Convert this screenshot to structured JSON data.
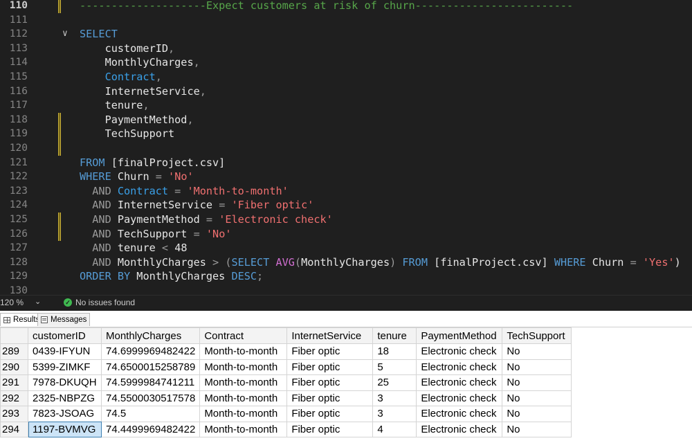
{
  "editor": {
    "lines": [
      {
        "num": "110",
        "current": true,
        "mark": true,
        "segments": [
          {
            "t": "--------------------Expect customers at risk of churn-------------------------",
            "c": "cm"
          }
        ]
      },
      {
        "num": "111",
        "segments": []
      },
      {
        "num": "112",
        "fold": true,
        "segments": [
          {
            "t": "SELECT",
            "c": "kw"
          }
        ]
      },
      {
        "num": "113",
        "segments": [
          {
            "t": "    customerID",
            "c": "ident"
          },
          {
            "t": ",",
            "c": "gray"
          }
        ]
      },
      {
        "num": "114",
        "segments": [
          {
            "t": "    MonthlyCharges",
            "c": "ident"
          },
          {
            "t": ",",
            "c": "gray"
          }
        ]
      },
      {
        "num": "115",
        "segments": [
          {
            "t": "    Contract",
            "c": "blue"
          },
          {
            "t": ",",
            "c": "gray"
          }
        ]
      },
      {
        "num": "116",
        "segments": [
          {
            "t": "    InternetService",
            "c": "ident"
          },
          {
            "t": ",",
            "c": "gray"
          }
        ]
      },
      {
        "num": "117",
        "segments": [
          {
            "t": "    tenure",
            "c": "ident"
          },
          {
            "t": ",",
            "c": "gray"
          }
        ]
      },
      {
        "num": "118",
        "mark": true,
        "segments": [
          {
            "t": "    PaymentMethod",
            "c": "ident"
          },
          {
            "t": ",",
            "c": "gray"
          }
        ]
      },
      {
        "num": "119",
        "mark": true,
        "segments": [
          {
            "t": "    TechSupport",
            "c": "ident"
          }
        ]
      },
      {
        "num": "120",
        "mark": true,
        "segments": []
      },
      {
        "num": "121",
        "segments": [
          {
            "t": "FROM ",
            "c": "kw"
          },
          {
            "t": "[finalProject.csv]",
            "c": "ident"
          }
        ]
      },
      {
        "num": "122",
        "segments": [
          {
            "t": "WHERE ",
            "c": "kw"
          },
          {
            "t": "Churn ",
            "c": "ident"
          },
          {
            "t": "= ",
            "c": "gray"
          },
          {
            "t": "'No'",
            "c": "str"
          }
        ]
      },
      {
        "num": "123",
        "segments": [
          {
            "t": "  AND ",
            "c": "gray"
          },
          {
            "t": "Contract ",
            "c": "blue"
          },
          {
            "t": "= ",
            "c": "gray"
          },
          {
            "t": "'Month-to-month'",
            "c": "str"
          }
        ]
      },
      {
        "num": "124",
        "segments": [
          {
            "t": "  AND ",
            "c": "gray"
          },
          {
            "t": "InternetService ",
            "c": "ident"
          },
          {
            "t": "= ",
            "c": "gray"
          },
          {
            "t": "'Fiber optic'",
            "c": "str"
          }
        ]
      },
      {
        "num": "125",
        "mark": true,
        "segments": [
          {
            "t": "  AND ",
            "c": "gray"
          },
          {
            "t": "PaymentMethod ",
            "c": "ident"
          },
          {
            "t": "= ",
            "c": "gray"
          },
          {
            "t": "'Electronic check'",
            "c": "str"
          }
        ]
      },
      {
        "num": "126",
        "mark": true,
        "segments": [
          {
            "t": "  AND ",
            "c": "gray"
          },
          {
            "t": "TechSupport ",
            "c": "ident"
          },
          {
            "t": "= ",
            "c": "gray"
          },
          {
            "t": "'No'",
            "c": "str"
          }
        ]
      },
      {
        "num": "127",
        "segments": [
          {
            "t": "  AND ",
            "c": "gray"
          },
          {
            "t": "tenure ",
            "c": "ident"
          },
          {
            "t": "< ",
            "c": "gray"
          },
          {
            "t": "48",
            "c": "ident"
          }
        ]
      },
      {
        "num": "128",
        "segments": [
          {
            "t": "  AND ",
            "c": "gray"
          },
          {
            "t": "MonthlyCharges ",
            "c": "ident"
          },
          {
            "t": "> (",
            "c": "gray"
          },
          {
            "t": "SELECT ",
            "c": "kw"
          },
          {
            "t": "AVG",
            "c": "fn"
          },
          {
            "t": "(",
            "c": "gray"
          },
          {
            "t": "MonthlyCharges",
            "c": "ident"
          },
          {
            "t": ") ",
            "c": "gray"
          },
          {
            "t": "FROM ",
            "c": "kw"
          },
          {
            "t": "[finalProject.csv] ",
            "c": "ident"
          },
          {
            "t": "WHERE ",
            "c": "kw"
          },
          {
            "t": "Churn ",
            "c": "ident"
          },
          {
            "t": "= ",
            "c": "gray"
          },
          {
            "t": "'Yes'",
            "c": "str"
          },
          {
            "t": ")",
            "c": "ident"
          }
        ]
      },
      {
        "num": "129",
        "segments": [
          {
            "t": "ORDER BY ",
            "c": "kw"
          },
          {
            "t": "MonthlyCharges ",
            "c": "ident"
          },
          {
            "t": "DESC",
            "c": "kw"
          },
          {
            "t": ";",
            "c": "gray"
          }
        ]
      },
      {
        "num": "130",
        "segments": []
      }
    ]
  },
  "status": {
    "zoom": "120 %",
    "issues": "No issues found"
  },
  "tabs": {
    "results": "Results",
    "messages": "Messages"
  },
  "grid": {
    "columns": [
      "customerID",
      "MonthlyCharges",
      "Contract",
      "InternetService",
      "tenure",
      "PaymentMethod",
      "TechSupport"
    ],
    "rows": [
      {
        "num": "289",
        "cells": [
          "0439-IFYUN",
          "74.6999969482422",
          "Month-to-month",
          "Fiber optic",
          "18",
          "Electronic check",
          "No"
        ]
      },
      {
        "num": "290",
        "cells": [
          "5399-ZIMKF",
          "74.6500015258789",
          "Month-to-month",
          "Fiber optic",
          "5",
          "Electronic check",
          "No"
        ]
      },
      {
        "num": "291",
        "cells": [
          "7978-DKUQH",
          "74.5999984741211",
          "Month-to-month",
          "Fiber optic",
          "25",
          "Electronic check",
          "No"
        ]
      },
      {
        "num": "292",
        "cells": [
          "2325-NBPZG",
          "74.5500030517578",
          "Month-to-month",
          "Fiber optic",
          "3",
          "Electronic check",
          "No"
        ]
      },
      {
        "num": "293",
        "cells": [
          "7823-JSOAG",
          "74.5",
          "Month-to-month",
          "Fiber optic",
          "3",
          "Electronic check",
          "No"
        ]
      },
      {
        "num": "294",
        "selectedCol": 0,
        "cells": [
          "1197-BVMVG",
          "74.4499969482422",
          "Month-to-month",
          "Fiber optic",
          "4",
          "Electronic check",
          "No"
        ]
      }
    ]
  }
}
